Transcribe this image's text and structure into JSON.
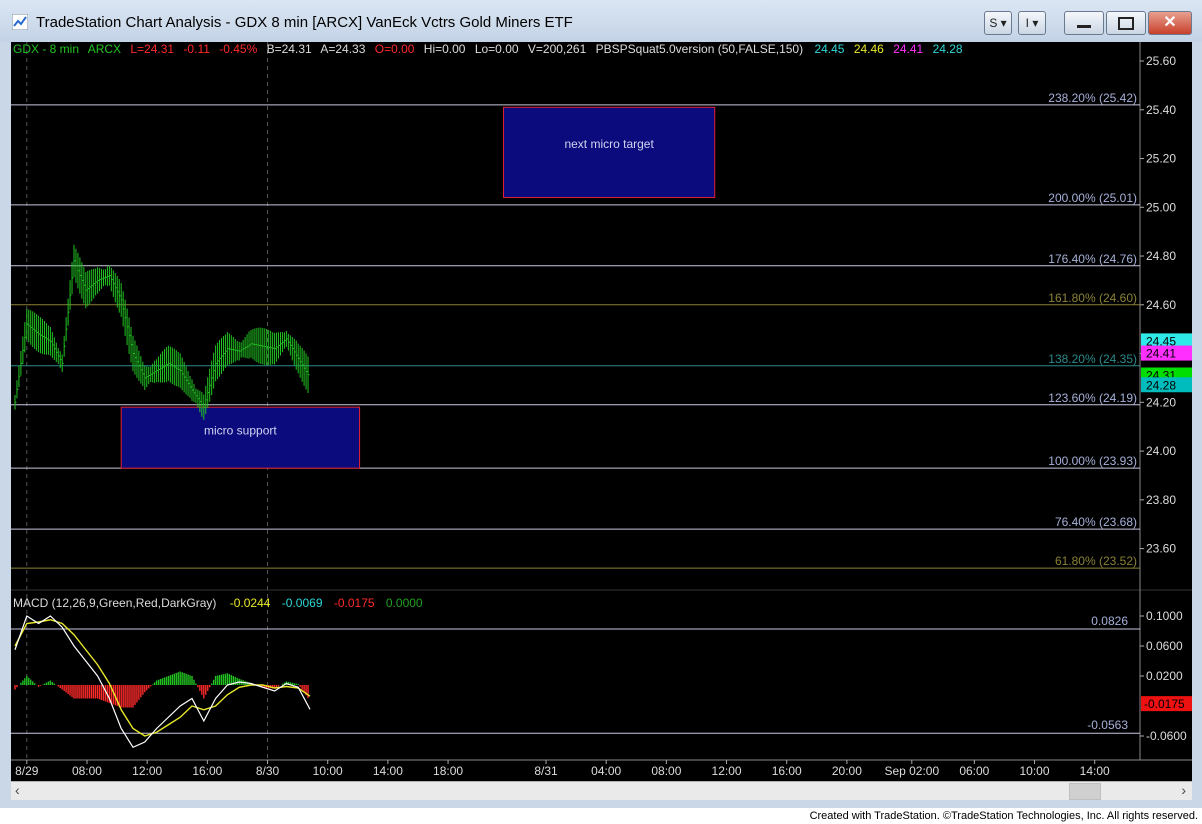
{
  "window": {
    "title": "TradeStation Chart Analysis - GDX 8 min [ARCX] VanEck Vctrs Gold Miners ETF",
    "buttons": {
      "s_label": "S",
      "i_label": "I"
    }
  },
  "header": {
    "symbol": "GDX - 8 min",
    "exchange": "ARCX",
    "last": "L=24.31",
    "change": "-0.11",
    "change_pct": "-0.45%",
    "bid": "B=24.31",
    "ask": "A=24.33",
    "open": "O=0.00",
    "hi": "Hi=0.00",
    "lo": "Lo=0.00",
    "volume": "V=200,261",
    "indicator": "PBSPSquat5.0version (50,FALSE,150)",
    "ind_v1": "24.45",
    "ind_v2": "24.46",
    "ind_v3": "24.41",
    "ind_v4": "24.28"
  },
  "colors": {
    "green": "#22c422",
    "red": "#ff2a2a",
    "cyan": "#2fd6d6",
    "yellow": "#e8e82a",
    "magenta": "#ff30ff",
    "fib_line": "#c8c8e0",
    "fib_text": "#a6b0d8",
    "fib_gold": "#8a8235",
    "fib_teal": "#2a8a8a"
  },
  "boxes": {
    "target": {
      "label": "next micro target",
      "price_top": 25.41,
      "price_bottom": 25.04,
      "t_start": 41.4,
      "t_end": 59.3
    },
    "support": {
      "label": "micro support",
      "price_top": 24.18,
      "price_bottom": 23.93,
      "t_start": 9.0,
      "t_end": 29.2
    }
  },
  "price_ticks": [
    "25.60",
    "25.40",
    "25.20",
    "25.00",
    "24.80",
    "24.60",
    "24.40",
    "24.20",
    "24.00",
    "23.80",
    "23.60"
  ],
  "fib_levels": [
    {
      "label": "238.20% (25.42)",
      "price": 25.42,
      "style": "normal"
    },
    {
      "label": "200.00% (25.01)",
      "price": 25.01,
      "style": "normal"
    },
    {
      "label": "176.40% (24.76)",
      "price": 24.76,
      "style": "normal"
    },
    {
      "label": "161.80% (24.60)",
      "price": 24.6,
      "style": "gold"
    },
    {
      "label": "138.20% (24.35)",
      "price": 24.35,
      "style": "teal"
    },
    {
      "label": "123.60% (24.19)",
      "price": 24.19,
      "style": "normal"
    },
    {
      "label": "100.00% (23.93)",
      "price": 23.93,
      "style": "normal"
    },
    {
      "label": "76.40% (23.68)",
      "price": 23.68,
      "style": "normal"
    },
    {
      "label": "61.80% (23.52)",
      "price": 23.52,
      "style": "gold"
    }
  ],
  "price_badges": [
    {
      "value": "24.45",
      "price": 24.45,
      "bg": "#2fe8e8",
      "fg": "#000000"
    },
    {
      "value": "24.41",
      "price": 24.4,
      "bg": "#ff30ff",
      "fg": "#000000"
    },
    {
      "value": "24.31",
      "price": 24.31,
      "bg": "#00dd00",
      "fg": "#000000"
    },
    {
      "value": "24.28",
      "price": 24.27,
      "bg": "#00bcbc",
      "fg": "#000000"
    }
  ],
  "macd": {
    "label": "MACD (12,26,9,Green,Red,DarkGray)",
    "v_macd": "-0.0244",
    "v_signal": "-0.0069",
    "v_diff": "-0.0175",
    "v_zero": "0.0000",
    "upper_level": "0.0826",
    "lower_level": "-0.0563",
    "ticks": [
      "0.1000",
      "0.0600",
      "0.0200",
      "-0.0600"
    ],
    "badge": "-0.0175"
  },
  "time_axis": [
    {
      "label": "8/29",
      "t": 1
    },
    {
      "label": "08:00",
      "t": 6.1
    },
    {
      "label": "12:00",
      "t": 11.2
    },
    {
      "label": "16:00",
      "t": 16.3
    },
    {
      "label": "8/30",
      "t": 21.4
    },
    {
      "label": "10:00",
      "t": 26.5
    },
    {
      "label": "14:00",
      "t": 31.6
    },
    {
      "label": "18:00",
      "t": 36.7
    },
    {
      "label": "8/31",
      "t": 45.0
    },
    {
      "label": "04:00",
      "t": 50.1
    },
    {
      "label": "08:00",
      "t": 55.2
    },
    {
      "label": "12:00",
      "t": 60.3
    },
    {
      "label": "16:00",
      "t": 65.4
    },
    {
      "label": "20:00",
      "t": 70.5
    },
    {
      "label": "Sep 02:00",
      "t": 76.0
    },
    {
      "label": "06:00",
      "t": 81.3
    },
    {
      "label": "10:00",
      "t": 86.4
    },
    {
      "label": "14:00",
      "t": 91.5
    }
  ],
  "chart_data": {
    "type": "line",
    "title": "GDX - 8 min",
    "xlabel": "",
    "ylabel": "",
    "ylim": [
      23.4,
      25.64
    ],
    "price_series": {
      "name": "GDX",
      "t": [
        0,
        1,
        2,
        3,
        4,
        5,
        6,
        7,
        8,
        9,
        10,
        11,
        12,
        13,
        14,
        15,
        16,
        17,
        18,
        19,
        20,
        21,
        22,
        23,
        24,
        25
      ],
      "y": [
        24.2,
        24.52,
        24.48,
        24.45,
        24.36,
        24.78,
        24.66,
        24.7,
        24.72,
        24.62,
        24.4,
        24.3,
        24.33,
        24.36,
        24.33,
        24.25,
        24.18,
        24.36,
        24.42,
        24.41,
        24.44,
        24.43,
        24.42,
        24.46,
        24.38,
        24.3
      ]
    },
    "macd_series": [
      {
        "name": "MACD",
        "t": [
          0,
          1,
          2,
          3,
          4,
          5,
          6,
          7,
          8,
          9,
          10,
          11,
          12,
          13,
          14,
          15,
          16,
          17,
          18,
          19,
          20,
          21,
          22,
          23,
          24,
          25
        ],
        "y": [
          0.055,
          0.1,
          0.09,
          0.1,
          0.085,
          0.06,
          0.04,
          0.02,
          -0.01,
          -0.05,
          -0.075,
          -0.068,
          -0.05,
          -0.035,
          -0.02,
          -0.01,
          -0.04,
          -0.01,
          0.008,
          0.012,
          0.01,
          0.005,
          0.0,
          0.01,
          0.005,
          -0.0244
        ]
      },
      {
        "name": "Signal",
        "t": [
          0,
          1,
          2,
          3,
          4,
          5,
          6,
          7,
          8,
          9,
          10,
          11,
          12,
          13,
          14,
          15,
          16,
          17,
          18,
          19,
          20,
          21,
          22,
          23,
          24,
          25
        ],
        "y": [
          0.06,
          0.09,
          0.092,
          0.095,
          0.09,
          0.075,
          0.055,
          0.035,
          0.01,
          -0.025,
          -0.05,
          -0.06,
          -0.055,
          -0.045,
          -0.035,
          -0.02,
          -0.025,
          -0.02,
          -0.005,
          0.005,
          0.008,
          0.008,
          0.004,
          0.006,
          0.004,
          -0.0069
        ]
      }
    ],
    "macd_ylim": [
      -0.075,
      0.112
    ]
  },
  "footer": {
    "credit": "Created with TradeStation. ©TradeStation Technologies, Inc. All rights reserved."
  }
}
